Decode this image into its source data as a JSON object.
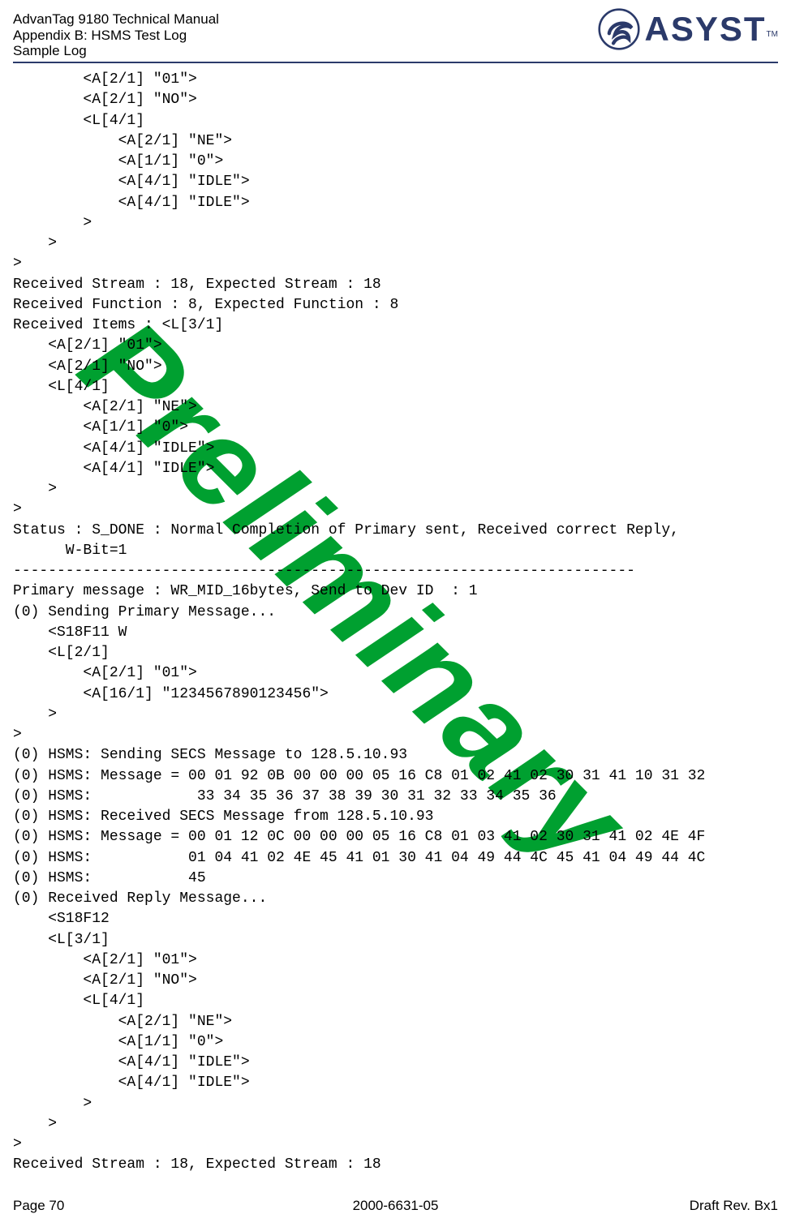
{
  "header": {
    "title": "AdvanTag 9180 Technical Manual",
    "subtitle1": "Appendix B: HSMS Test Log",
    "subtitle2": "Sample Log",
    "brand": "ASYST",
    "tm": "TM"
  },
  "watermark": "Preliminary",
  "log_text": "        <A[2/1] \"01\">\n        <A[2/1] \"NO\">\n        <L[4/1]\n            <A[2/1] \"NE\">\n            <A[1/1] \"0\">\n            <A[4/1] \"IDLE\">\n            <A[4/1] \"IDLE\">\n        >\n    >\n>\nReceived Stream : 18, Expected Stream : 18\nReceived Function : 8, Expected Function : 8\nReceived Items : <L[3/1]\n    <A[2/1] \"01\">\n    <A[2/1] \"NO\">\n    <L[4/1]\n        <A[2/1] \"NE\">\n        <A[1/1] \"0\">\n        <A[4/1] \"IDLE\">\n        <A[4/1] \"IDLE\">\n    >\n>\nStatus : S_DONE : Normal Completion of Primary sent, Received correct Reply,\n      W-Bit=1\n-----------------------------------------------------------------------\nPrimary message : WR_MID_16bytes, Send to Dev ID  : 1\n(0) Sending Primary Message...\n    <S18F11 W\n    <L[2/1]\n        <A[2/1] \"01\">\n        <A[16/1] \"1234567890123456\">\n    >\n>\n(0) HSMS: Sending SECS Message to 128.5.10.93\n(0) HSMS: Message = 00 01 92 0B 00 00 00 05 16 C8 01 02 41 02 30 31 41 10 31 32\n(0) HSMS:            33 34 35 36 37 38 39 30 31 32 33 34 35 36\n(0) HSMS: Received SECS Message from 128.5.10.93\n(0) HSMS: Message = 00 01 12 0C 00 00 00 05 16 C8 01 03 41 02 30 31 41 02 4E 4F\n(0) HSMS:           01 04 41 02 4E 45 41 01 30 41 04 49 44 4C 45 41 04 49 44 4C\n(0) HSMS:           45\n(0) Received Reply Message...\n    <S18F12\n    <L[3/1]\n        <A[2/1] \"01\">\n        <A[2/1] \"NO\">\n        <L[4/1]\n            <A[2/1] \"NE\">\n            <A[1/1] \"0\">\n            <A[4/1] \"IDLE\">\n            <A[4/1] \"IDLE\">\n        >\n    >\n>\nReceived Stream : 18, Expected Stream : 18",
  "footer": {
    "left": "Page 70",
    "center": "2000-6631-05",
    "right": "Draft Rev. Bx1"
  }
}
